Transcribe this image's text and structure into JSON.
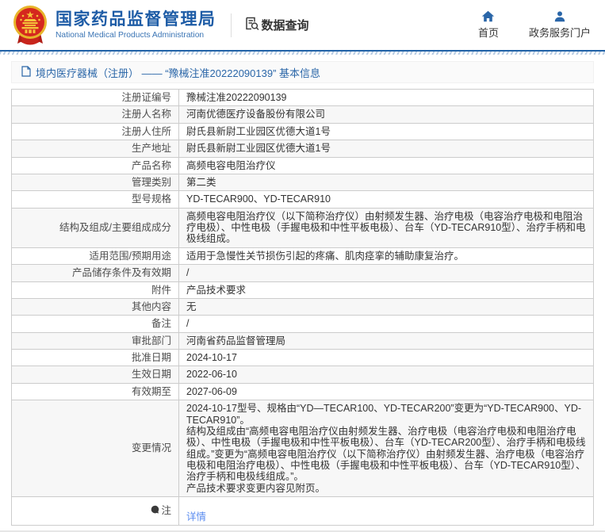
{
  "header": {
    "title_cn": "国家药品监督管理局",
    "title_en": "National Medical Products Administration",
    "data_query_label": "数据查询",
    "nav": [
      {
        "label": "首页",
        "icon": "home-icon"
      },
      {
        "label": "政务服务门户",
        "icon": "user-icon"
      }
    ]
  },
  "breadcrumb": {
    "text": "境内医疗器械（注册） —— “豫械注准20222090139” 基本信息"
  },
  "table": {
    "rows": [
      {
        "label": "注册证编号",
        "value": "豫械注准20222090139"
      },
      {
        "label": "注册人名称",
        "value": "河南优德医疗设备股份有限公司"
      },
      {
        "label": "注册人住所",
        "value": "尉氏县新尉工业园区优德大道1号"
      },
      {
        "label": "生产地址",
        "value": "尉氏县新尉工业园区优德大道1号"
      },
      {
        "label": "产品名称",
        "value": "高频电容电阻治疗仪"
      },
      {
        "label": "管理类别",
        "value": "第二类"
      },
      {
        "label": "型号规格",
        "value": "YD-TECAR900、YD-TECAR910"
      },
      {
        "label": "结构及组成/主要组成成分",
        "value": "高频电容电阻治疗仪（以下简称治疗仪）由射频发生器、治疗电极（电容治疗电极和电阻治疗电极）、中性电极（手握电极和中性平板电极）、台车（YD-TECAR910型）、治疗手柄和电极线组成。"
      },
      {
        "label": "适用范围/预期用途",
        "value": "适用于急慢性关节损伤引起的疼痛、肌肉痉挛的辅助康复治疗。"
      },
      {
        "label": "产品储存条件及有效期",
        "value": "/"
      },
      {
        "label": "附件",
        "value": "产品技术要求"
      },
      {
        "label": "其他内容",
        "value": "无"
      },
      {
        "label": "备注",
        "value": "/"
      },
      {
        "label": "审批部门",
        "value": "河南省药品监督管理局"
      },
      {
        "label": "批准日期",
        "value": "2024-10-17"
      },
      {
        "label": "生效日期",
        "value": "2022-06-10"
      },
      {
        "label": "有效期至",
        "value": "2027-06-09"
      },
      {
        "label": "变更情况",
        "value": "2024-10-17型号、规格由“YD—TECAR100、YD-TECAR200”变更为“YD-TECAR900、YD-TECAR910”。\n结构及组成由“高频电容电阻治疗仪由射频发生器、治疗电极（电容治疗电极和电阻治疗电极）、中性电极（手握电极和中性平板电极）、台车（YD-TECAR200型）、治疗手柄和电极线组成。”变更为“高频电容电阻治疗仪（以下简称治疗仪）由射频发生器、治疗电极（电容治疗电极和电阻治疗电极）、中性电极（手握电极和中性平板电极）、台车（YD-TECAR910型）、治疗手柄和电极线组成。”。\n产品技术要求变更内容见附页。"
      }
    ],
    "note_row": {
      "label": "注",
      "link_text": "详情"
    }
  },
  "colors": {
    "brand_blue": "#1e5ca6",
    "link_blue": "#5a8cf0",
    "separator_blue": "#2263a7",
    "border_gray": "#cccccc",
    "alt_row_bg": "#f7f7f7",
    "emblem_red": "#d5281e",
    "emblem_gold": "#f0c030"
  }
}
